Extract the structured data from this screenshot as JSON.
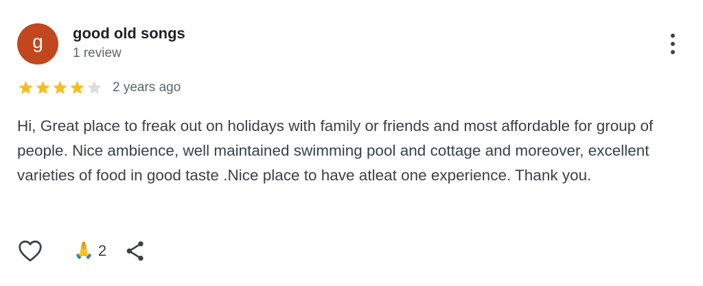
{
  "review": {
    "avatar_letter": "g",
    "avatar_color": "#c2471e",
    "author": "good old songs",
    "review_count": "1 review",
    "rating": 4,
    "rating_max": 5,
    "time": "2 years ago",
    "text": "Hi, Great place to freak out on holidays with family or friends and most affordable for group of people. Nice ambience, well maintained swimming pool and cottage and moreover, excellent varieties of food in good taste .Nice place to have atleat one experience. Thank you.",
    "reactions": {
      "like_icon": "heart-outline-icon",
      "reaction_icon": "folded-hands-icon",
      "reaction_glyph": "🙏",
      "reaction_count": "2",
      "share_icon": "share-icon"
    }
  },
  "colors": {
    "star_filled": "#f5bd1f",
    "star_empty": "#dadce0",
    "secondary_text": "#5f6368",
    "body_text": "#3c4043"
  }
}
